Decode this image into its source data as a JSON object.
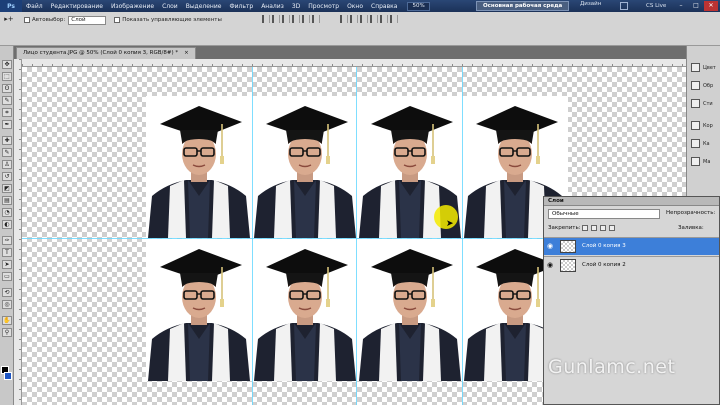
{
  "menubar": {
    "logo": "Ps",
    "items": [
      "Файл",
      "Редактирование",
      "Изображение",
      "Слои",
      "Выделение",
      "Фильтр",
      "Анализ",
      "3D",
      "Просмотр",
      "Окно",
      "Справка"
    ],
    "zoom": "50%",
    "workspace_label": "Основная рабочая среда",
    "design_label": "Дизайн",
    "cs_live": "CS Live",
    "minimize": "–",
    "restore": "□",
    "close": "✕"
  },
  "options": {
    "tool_glyph": "▸+",
    "autoselect_label": "Автовыбор:",
    "autoselect_value": "Слой",
    "show_controls_label": "Показать управляющие элементы"
  },
  "document": {
    "tab_title": "Лицо студента.JPG @ 50% (Слой 0 копия 3, RGB/8#) *",
    "close": "×"
  },
  "icon_panel": {
    "items": [
      "Цвет",
      "Обр",
      "Сти",
      "Кор",
      "Ка",
      "Ма"
    ]
  },
  "layers": {
    "title": "Слои",
    "blend_mode": "Обычные",
    "opacity_label": "Непрозрачность:",
    "lock_label": "Закрепить:",
    "fill_label": "Заливка:",
    "rows": [
      {
        "name": "Слой 0 копия 3",
        "active": true
      },
      {
        "name": "Слой 0 копия 2",
        "active": false
      }
    ]
  },
  "watermark": "Gunlamc.net",
  "colors": {
    "menubar": "#1f3a66",
    "selected_layer": "#3d7fd9",
    "guide": "#5fd6ff",
    "cursor_highlight": "#f5eb00"
  }
}
